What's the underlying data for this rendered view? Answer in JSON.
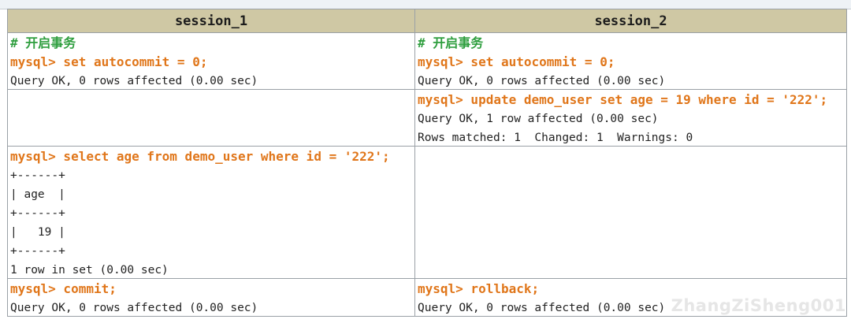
{
  "table": {
    "headers": [
      "session_1",
      "session_2"
    ],
    "rows": [
      {
        "session_1": [
          "# 开启事务",
          "mysql> set autocommit = 0;",
          "Query OK, 0 rows affected (0.00 sec)"
        ],
        "session_2": [
          "# 开启事务",
          "mysql> set autocommit = 0;",
          "Query OK, 0 rows affected (0.00 sec)"
        ]
      },
      {
        "session_1": [],
        "session_2": [
          "mysql> update demo_user set age = 19 where id = '222';",
          "Query OK, 1 row affected (0.00 sec)",
          "Rows matched: 1  Changed: 1  Warnings: 0"
        ]
      },
      {
        "session_1": [
          "mysql> select age from demo_user where id = '222';",
          "+------+",
          "| age  |",
          "+------+",
          "|   19 |",
          "+------+",
          "1 row in set (0.00 sec)"
        ],
        "session_2": []
      },
      {
        "session_1": [
          "mysql> commit;",
          "Query OK, 0 rows affected (0.00 sec)"
        ],
        "session_2": [
          "mysql> rollback;",
          "Query OK, 0 rows affected (0.00 sec)"
        ]
      }
    ]
  },
  "watermark": "ZhangZiSheng001",
  "colors": {
    "header_bg": "#cfc8a4",
    "comment": "#2e9e3e",
    "command": "#e0761a",
    "border": "#9aa0a6"
  }
}
